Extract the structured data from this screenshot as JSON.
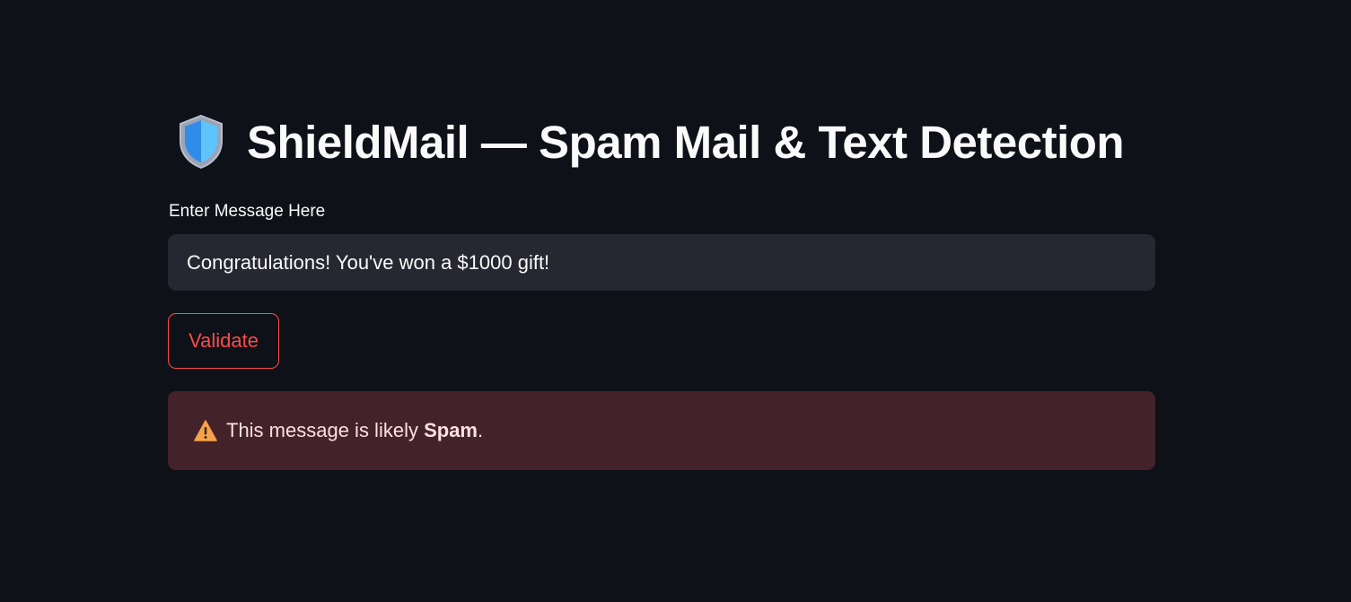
{
  "page": {
    "title_icon": "shield-icon",
    "title": "ShieldMail — Spam Mail & Text Detection"
  },
  "form": {
    "label": "Enter Message Here",
    "message_value": "Congratulations! You've won a $1000 gift!",
    "validate_label": "Validate"
  },
  "result": {
    "icon": "warning-icon",
    "text_before": "This message is likely ",
    "verdict": "Spam",
    "text_after": "."
  },
  "colors": {
    "background": "#0e1117",
    "input_bg": "#262730",
    "accent": "#ff4b4b",
    "alert_bg": "#432329",
    "text": "#fafafa"
  }
}
